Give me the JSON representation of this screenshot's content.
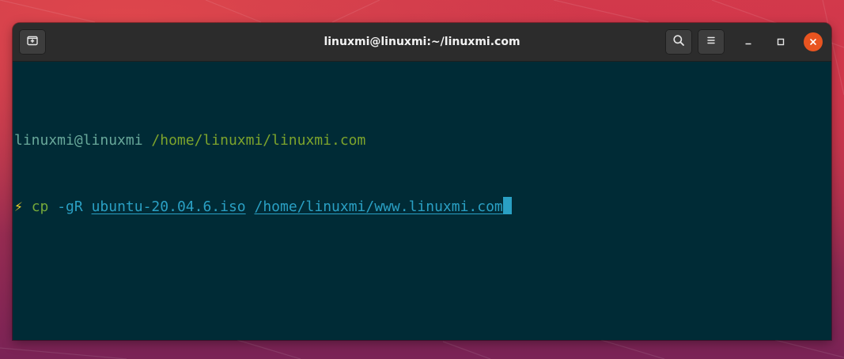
{
  "window": {
    "title": "linuxmi@linuxmi:~/linuxmi.com"
  },
  "headerbar": {
    "left_buttons": [
      {
        "icon": "new-tab-icon"
      }
    ],
    "right_buttons": [
      {
        "icon": "search-icon"
      },
      {
        "icon": "hamburger-menu-icon"
      }
    ],
    "window_controls": [
      {
        "icon": "minimize-icon"
      },
      {
        "icon": "maximize-icon"
      },
      {
        "icon": "close-icon"
      }
    ]
  },
  "terminal": {
    "prompt": {
      "user_host": "linuxmi@linuxmi",
      "cwd": "/home/linuxmi/linuxmi.com",
      "symbol": "⚡"
    },
    "command": {
      "program": "cp",
      "flags": "-gR",
      "source": "ubuntu-20.04.6.iso",
      "destination": "/home/linuxmi/www.linuxmi.com"
    }
  },
  "colors": {
    "terminal_background": "#002b36",
    "headerbar_background": "#2c2c2c",
    "close_button": "#e95420",
    "prompt_user": "#68a89a",
    "prompt_path": "#7da42c",
    "command": "#74a83a",
    "argument": "#2aa0c4",
    "bolt": "#f0d12a"
  }
}
